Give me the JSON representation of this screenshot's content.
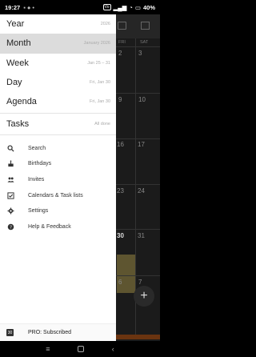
{
  "status_bar": {
    "time": "19:27",
    "battery": "40%"
  },
  "calendar_bg": {
    "day_headers": [
      "FRI",
      "SAT"
    ],
    "dates": [
      "2",
      "3",
      "9",
      "10",
      "16",
      "17",
      "23",
      "24",
      "30",
      "31",
      "6",
      "7"
    ]
  },
  "drawer": {
    "views": [
      {
        "label": "Year",
        "sub": "2026"
      },
      {
        "label": "Month",
        "sub": "January 2026"
      },
      {
        "label": "Week",
        "sub": "Jan 25 – 31"
      },
      {
        "label": "Day",
        "sub": "Fri, Jan 30"
      },
      {
        "label": "Agenda",
        "sub": "Fri, Jan 30"
      }
    ],
    "tasks": {
      "label": "Tasks",
      "sub": "All done"
    },
    "menu": [
      {
        "label": "Search",
        "icon": "search-icon"
      },
      {
        "label": "Birthdays",
        "icon": "cake-icon"
      },
      {
        "label": "Invites",
        "icon": "people-icon"
      },
      {
        "label": "Calendars & Task lists",
        "icon": "checklist-icon"
      },
      {
        "label": "Settings",
        "icon": "gear-icon"
      },
      {
        "label": "Help & Feedback",
        "icon": "help-icon"
      }
    ],
    "footer": {
      "label": "PRO: Subscribed",
      "icon_text": "30"
    }
  },
  "fab": {
    "label": "+"
  }
}
